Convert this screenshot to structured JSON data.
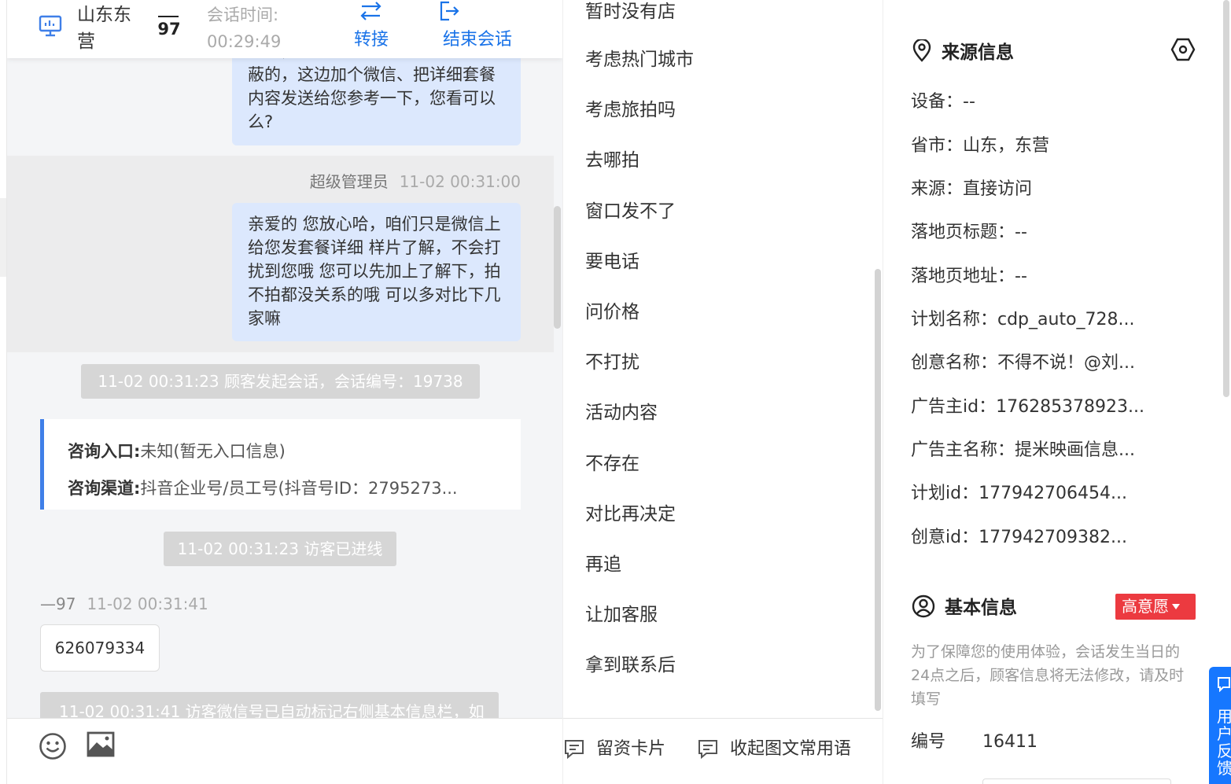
{
  "header": {
    "visitor_location": "山东东营",
    "visitor_id": "97",
    "session_time_label": "会话时间:",
    "session_time_value": "00:29:49",
    "transfer_label": "转接",
    "end_label": "结束会话"
  },
  "messages": {
    "agent_bubble_1": "快剧，技上上的价格 负相赚的会屏蔽的，这边加个微信、把详细套餐内容发送给您参考一下，您看可以么?",
    "agent_name": "超级管理员",
    "agent_time": "11-02 00:31:00",
    "agent_bubble_2": "亲爱的 您放心哈，咱们只是微信上给您发套餐详细 样片了解，不会打扰到您哦 您可以先加上了解下，拍不拍都没关系的哦 可以多对比下几家嘛",
    "system_start": "11-02 00:31:23 顾客发起会话，会话编号：19738",
    "entry_label": "咨询入口:",
    "entry_value": "未知(暂无入口信息)",
    "channel_label": "咨询渠道:",
    "channel_value": "抖音企业号/员工号(抖音号ID：2795273...",
    "system_connected": "11-02 00:31:23 访客已进线",
    "guest_name": "—97",
    "guest_time": "11-02 00:31:41",
    "guest_bubble": "626079334",
    "system_wechat": "11-02 00:31:41 访客微信号已自动标记右侧基本信息栏，如"
  },
  "phrases": {
    "items": [
      "暂时没有店",
      "考虑热门城市",
      "考虑旅拍吗",
      "去哪拍",
      "窗口发不了",
      "要电话",
      "问价格",
      "不打扰",
      "活动内容",
      "不存在",
      "对比再决定",
      "再追",
      "让加客服",
      "拿到联系后"
    ],
    "card_button": "留资卡片",
    "collapse_button": "收起图文常用语"
  },
  "source_info": {
    "title": "来源信息",
    "device": "设备：--",
    "province_city": "省市：山东，东营",
    "source": "来源：直接访问",
    "landing_title": "落地页标题：--",
    "landing_url": "落地页地址：--",
    "plan_name": "计划名称：cdp_auto_728...",
    "creative_name": "创意名称：不得不说！@刘...",
    "advertiser_id": "广告主id：176285378923...",
    "advertiser_name": "广告主名称：提米映画信息...",
    "plan_id": "计划id：177942706454...",
    "creative_id": "创意id：177942709382..."
  },
  "basic_info": {
    "title": "基本信息",
    "intent_badge": "高意愿",
    "notice": "为了保障您的使用体验，会话发生当日的24点之后，顾客信息将无法修改，请及时填写",
    "number_label": "编号",
    "number_value": "16411"
  },
  "feedback": {
    "label": "用户反馈"
  },
  "colors": {
    "accent": "#1a73e8",
    "agent_bubble": "#dce8fd",
    "intent_badge": "#ec3a40",
    "feedback_tab": "#1677ff"
  }
}
